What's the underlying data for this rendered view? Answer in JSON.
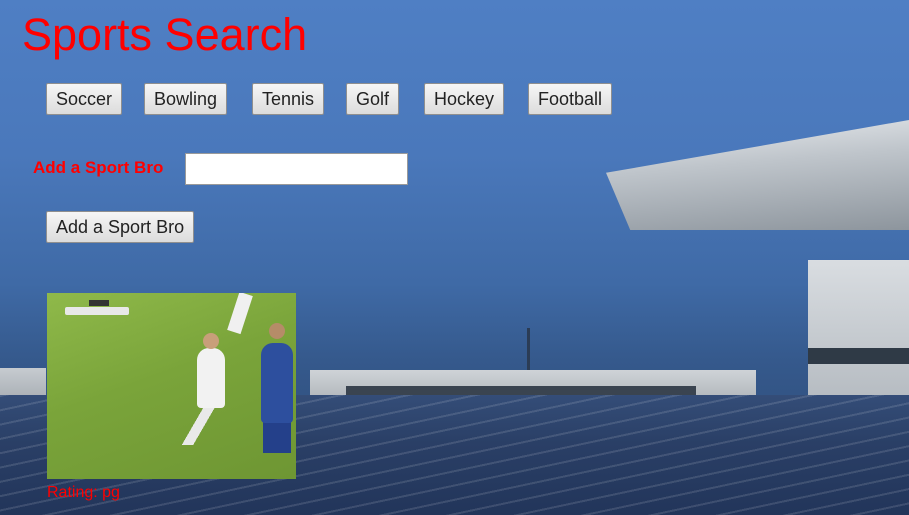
{
  "page": {
    "title": "Sports Search"
  },
  "sports": [
    "Soccer",
    "Bowling",
    "Tennis",
    "Golf",
    "Hockey",
    "Football"
  ],
  "form": {
    "label": "Add a Sport Bro",
    "input_value": "",
    "button_label": "Add a Sport Bro"
  },
  "results": [
    {
      "image": "soccer-headbutt-gif",
      "rating": "Rating: pg"
    }
  ],
  "colors": {
    "title": "#ff0000",
    "label": "#ff0000",
    "rating": "#ff0000"
  }
}
